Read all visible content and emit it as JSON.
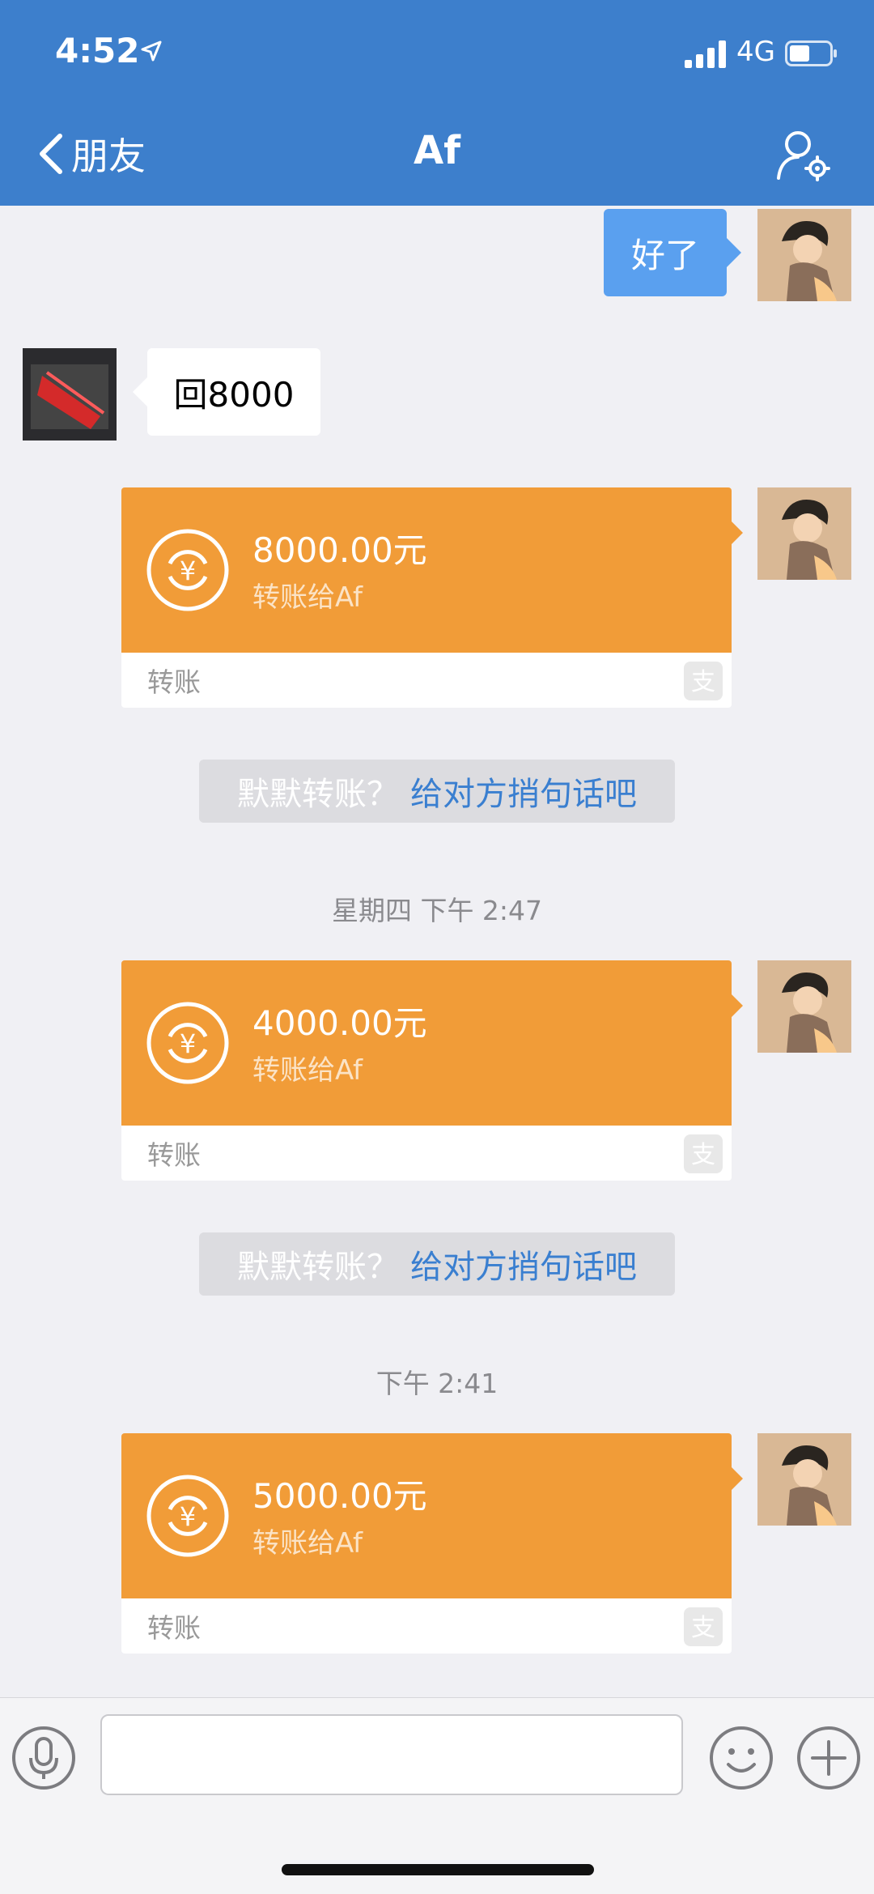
{
  "status_bar": {
    "time": "4:52",
    "network": "4G"
  },
  "nav": {
    "back_label": "朋友",
    "title": "Af"
  },
  "messages": {
    "outgoing_text": "好了",
    "incoming_text": "回8000"
  },
  "transfers": [
    {
      "amount": "8000.00元",
      "desc": "转账给Af",
      "label": "转账"
    },
    {
      "amount": "4000.00元",
      "desc": "转账给Af",
      "label": "转账"
    },
    {
      "amount": "5000.00元",
      "desc": "转账给Af",
      "label": "转账"
    }
  ],
  "notices": [
    {
      "prefix": "默默转账？",
      "link": "给对方捎句话吧"
    },
    {
      "prefix": "默默转账？",
      "link": "给对方捎句话吧"
    }
  ],
  "timestamps": [
    "星期四 下午 2:47",
    "下午 2:41"
  ],
  "input": {
    "placeholder": ""
  },
  "colors": {
    "header": "#3d7fcc",
    "transfer": "#f19c38",
    "outgoing_bubble": "#5aa0ef",
    "link": "#3a7fd0"
  }
}
